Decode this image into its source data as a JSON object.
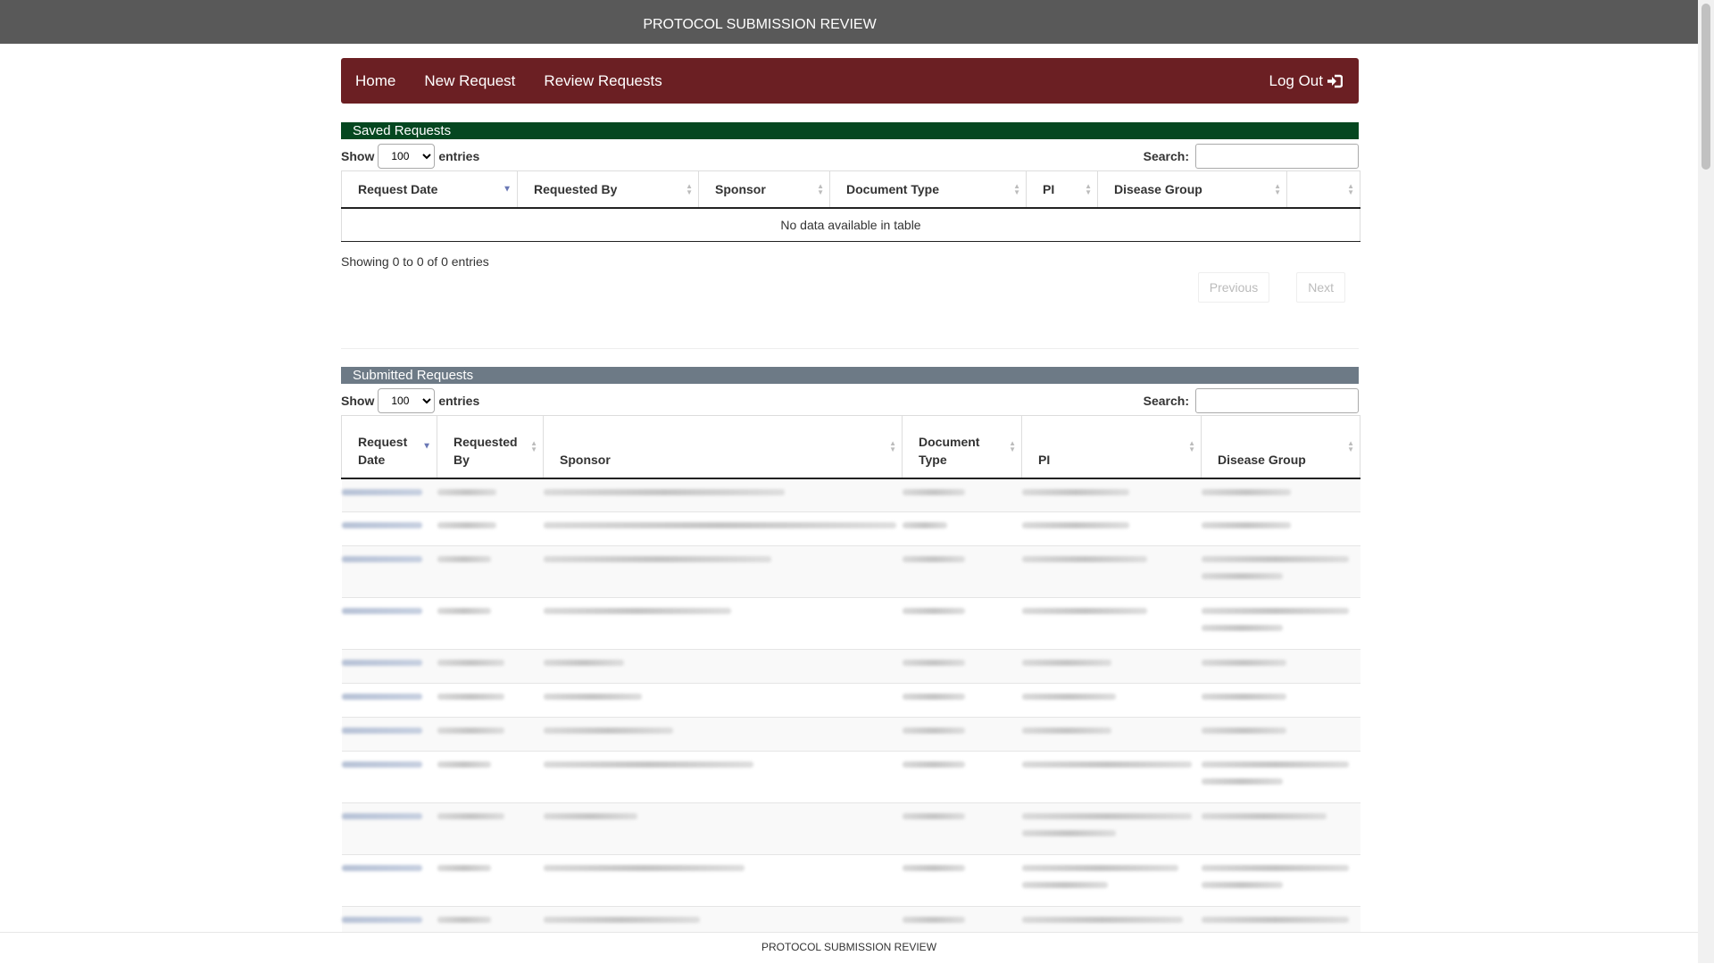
{
  "app": {
    "title": "PROTOCOL SUBMISSION REVIEW",
    "footer": "PROTOCOL SUBMISSION REVIEW"
  },
  "nav": {
    "items": [
      "Home",
      "New Request",
      "Review Requests"
    ],
    "logout": "Log Out"
  },
  "saved": {
    "title": "Saved Requests",
    "show_label": "Show",
    "entries_label": "entries",
    "page_size": "100",
    "search_label": "Search:",
    "columns": [
      "Request Date",
      "Requested By",
      "Sponsor",
      "Document Type",
      "PI",
      "Disease Group",
      ""
    ],
    "empty_text": "No data available in table",
    "info": "Showing 0 to 0 of 0 entries",
    "prev_label": "Previous",
    "next_label": "Next"
  },
  "submitted": {
    "title": "Submitted Requests",
    "show_label": "Show",
    "entries_label": "entries",
    "page_size": "100",
    "search_label": "Search:",
    "columns": [
      [
        "Request",
        "Date"
      ],
      [
        "Requested",
        "By"
      ],
      [
        "Sponsor"
      ],
      [
        "Document",
        "Type"
      ],
      [
        "PI"
      ],
      [
        "Disease Group"
      ]
    ]
  },
  "colors": {
    "nav": "#6b1f23",
    "saved_bar": "#054720",
    "submitted_bar": "#6d7a86",
    "topbar": "#595959"
  }
}
